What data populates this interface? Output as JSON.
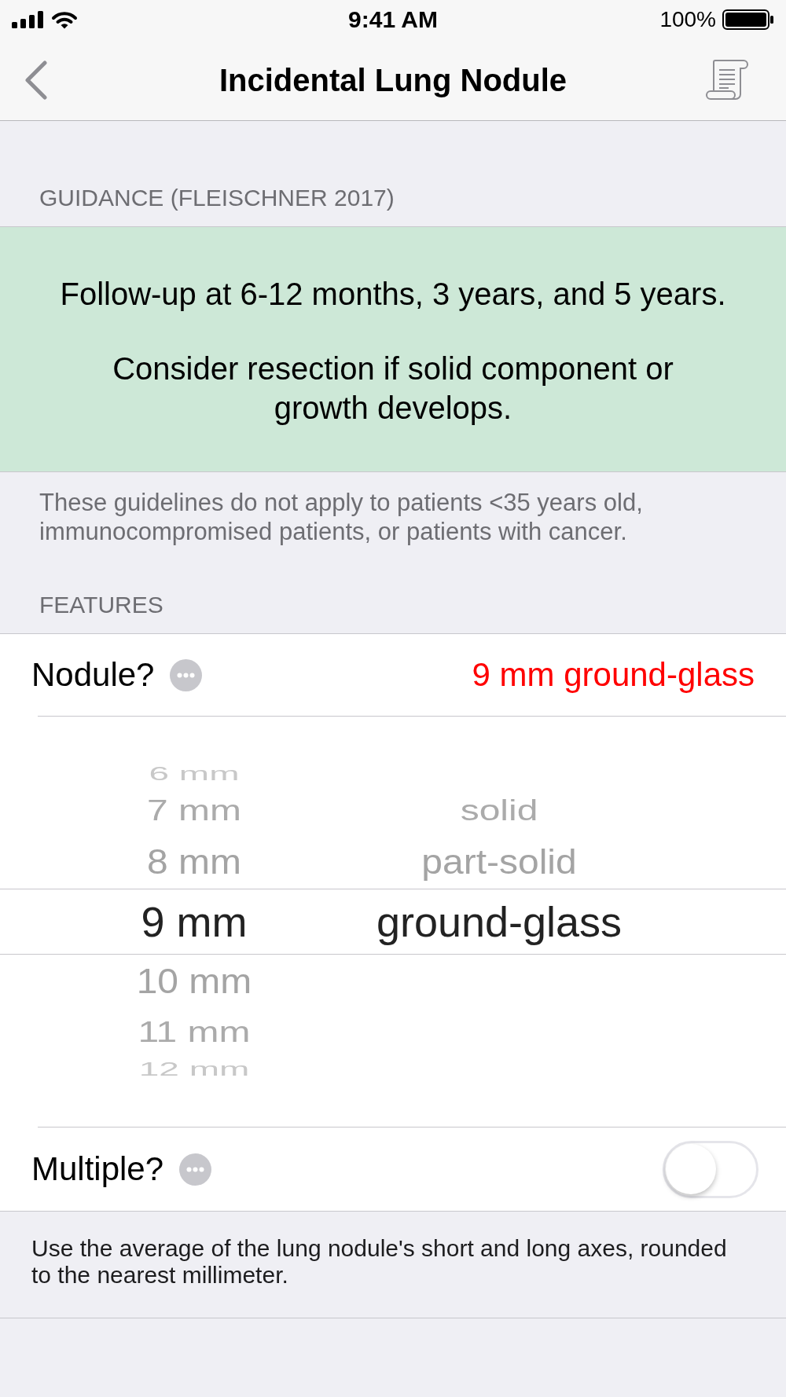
{
  "status_bar": {
    "time": "9:41 AM",
    "battery": "100%"
  },
  "nav_bar": {
    "title": "Incidental Lung Nodule"
  },
  "guidance": {
    "header": "GUIDANCE (FLEISCHNER 2017)",
    "paragraphs": [
      "Follow-up at 6-12 months, 3 years, and 5 years.",
      "Consider resection if solid component or growth develops."
    ],
    "footer": "These guidelines do not apply to patients <35 years old, immunocompromised patients, or patients with cancer."
  },
  "features": {
    "header": "FEATURES",
    "rows": [
      {
        "kind": "picker",
        "label": "Nodule?",
        "value": "9 mm ground-glass",
        "expanded": true,
        "picker": {
          "columns": [
            {
              "options": [
                {
                  "label": "6 mm",
                  "selected": false
                },
                {
                  "label": "7 mm",
                  "selected": false
                },
                {
                  "label": "8 mm",
                  "selected": false
                },
                {
                  "label": "9 mm",
                  "selected": true
                },
                {
                  "label": "10 mm",
                  "selected": false
                },
                {
                  "label": "11 mm",
                  "selected": false
                },
                {
                  "label": "12 mm",
                  "selected": false
                }
              ]
            },
            {
              "options": [
                {
                  "label": "solid",
                  "selected": false
                },
                {
                  "label": "part-solid",
                  "selected": false
                },
                {
                  "label": "ground-glass",
                  "selected": true
                }
              ]
            }
          ]
        }
      },
      {
        "kind": "toggle",
        "label": "Multiple?",
        "on": false
      }
    ],
    "footer": "Use the average of the lung nodule's short and long axes, rounded to the nearest millimeter."
  }
}
